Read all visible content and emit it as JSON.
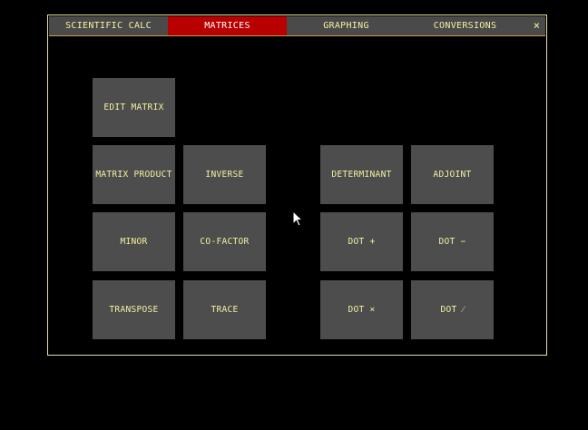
{
  "tabs": [
    {
      "label": "SCIENTIFIC CALC",
      "active": false
    },
    {
      "label": "MATRICES",
      "active": true
    },
    {
      "label": "GRAPHING",
      "active": false
    },
    {
      "label": "CONVERSIONS",
      "active": false
    }
  ],
  "close_label": "×",
  "buttons": {
    "edit_matrix": "EDIT MATRIX",
    "matrix_product": "MATRIX PRODUCT",
    "inverse": "INVERSE",
    "determinant": "DETERMINANT",
    "adjoint": "ADJOINT",
    "minor": "MINOR",
    "co_factor": "CO-FACTOR",
    "dot_plus": "DOT +",
    "dot_minus": "DOT −",
    "transpose": "TRANSPOSE",
    "trace": "TRACE",
    "dot_times": "DOT ×",
    "dot_divide": "DOT ⁄"
  },
  "colors": {
    "background": "#000000",
    "tab_bar": "#4a4a4a",
    "tab_active": "#b80000",
    "button": "#4d4d4d",
    "text": "#f5f1a0",
    "border": "#e6e29a"
  }
}
